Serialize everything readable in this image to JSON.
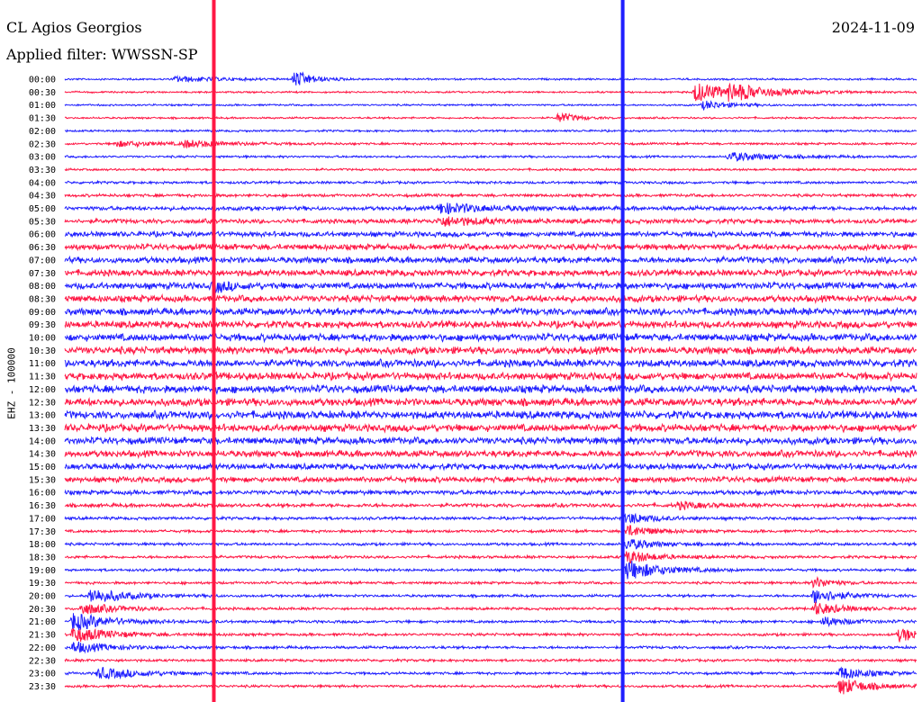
{
  "header": {
    "title": "CL Agios Georgios",
    "date": "2024-11-09",
    "filter": "Applied filter: WWSSN-SP"
  },
  "chart_data": {
    "type": "line",
    "title": "CL Agios Georgios",
    "subtitle": "Applied filter: WWSSN-SP",
    "ylabel": "EHZ - 100000",
    "date": "2024-11-09",
    "colors": [
      "#1f1fff",
      "#ff1744"
    ],
    "rows": [
      {
        "label": "00:00",
        "noise": 0.1,
        "events": [
          {
            "x": 0.27,
            "amp": 0.8,
            "decay": 0.02
          },
          {
            "x": 0.13,
            "amp": 0.25,
            "decay": 0.05
          }
        ]
      },
      {
        "label": "00:30",
        "noise": 0.1,
        "events": [
          {
            "x": 0.74,
            "amp": 0.9,
            "decay": 0.04
          },
          {
            "x": 0.78,
            "amp": 0.6,
            "decay": 0.05
          }
        ]
      },
      {
        "label": "01:00",
        "noise": 0.1,
        "events": [
          {
            "x": 0.75,
            "amp": 0.4,
            "decay": 0.03
          }
        ]
      },
      {
        "label": "01:30",
        "noise": 0.1,
        "events": [
          {
            "x": 0.58,
            "amp": 0.5,
            "decay": 0.02
          }
        ]
      },
      {
        "label": "02:00",
        "noise": 0.11,
        "events": []
      },
      {
        "label": "02:30",
        "noise": 0.12,
        "events": [
          {
            "x": 0.14,
            "amp": 0.3,
            "decay": 0.05
          },
          {
            "x": 0.06,
            "amp": 0.25,
            "decay": 0.05
          }
        ]
      },
      {
        "label": "03:00",
        "noise": 0.12,
        "events": [
          {
            "x": 0.78,
            "amp": 0.4,
            "decay": 0.05
          }
        ]
      },
      {
        "label": "03:30",
        "noise": 0.12,
        "events": []
      },
      {
        "label": "04:00",
        "noise": 0.14,
        "events": []
      },
      {
        "label": "04:30",
        "noise": 0.16,
        "events": []
      },
      {
        "label": "05:00",
        "noise": 0.22,
        "events": [
          {
            "x": 0.44,
            "amp": 0.5,
            "decay": 0.05
          }
        ]
      },
      {
        "label": "05:30",
        "noise": 0.24,
        "events": [
          {
            "x": 0.44,
            "amp": 0.4,
            "decay": 0.05
          }
        ]
      },
      {
        "label": "06:00",
        "noise": 0.28,
        "events": []
      },
      {
        "label": "06:30",
        "noise": 0.32,
        "events": []
      },
      {
        "label": "07:00",
        "noise": 0.34,
        "events": []
      },
      {
        "label": "07:30",
        "noise": 0.34,
        "events": []
      },
      {
        "label": "08:00",
        "noise": 0.36,
        "events": [
          {
            "x": 0.175,
            "amp": 0.5,
            "decay": 0.02
          }
        ]
      },
      {
        "label": "08:30",
        "noise": 0.36,
        "events": []
      },
      {
        "label": "09:00",
        "noise": 0.38,
        "events": []
      },
      {
        "label": "09:30",
        "noise": 0.38,
        "events": []
      },
      {
        "label": "10:00",
        "noise": 0.4,
        "events": []
      },
      {
        "label": "10:30",
        "noise": 0.4,
        "events": []
      },
      {
        "label": "11:00",
        "noise": 0.4,
        "events": []
      },
      {
        "label": "11:30",
        "noise": 0.4,
        "events": []
      },
      {
        "label": "12:00",
        "noise": 0.42,
        "events": []
      },
      {
        "label": "12:30",
        "noise": 0.42,
        "events": []
      },
      {
        "label": "13:00",
        "noise": 0.42,
        "events": []
      },
      {
        "label": "13:30",
        "noise": 0.4,
        "events": []
      },
      {
        "label": "14:00",
        "noise": 0.38,
        "events": []
      },
      {
        "label": "14:30",
        "noise": 0.36,
        "events": []
      },
      {
        "label": "15:00",
        "noise": 0.32,
        "events": []
      },
      {
        "label": "15:30",
        "noise": 0.3,
        "events": []
      },
      {
        "label": "16:00",
        "noise": 0.24,
        "events": []
      },
      {
        "label": "16:30",
        "noise": 0.2,
        "events": [
          {
            "x": 0.72,
            "amp": 0.3,
            "decay": 0.03
          }
        ]
      },
      {
        "label": "17:00",
        "noise": 0.16,
        "events": [
          {
            "x": 0.66,
            "amp": 0.5,
            "decay": 0.03
          }
        ]
      },
      {
        "label": "17:30",
        "noise": 0.15,
        "events": [
          {
            "x": 0.66,
            "amp": 0.5,
            "decay": 0.03
          }
        ]
      },
      {
        "label": "18:00",
        "noise": 0.15,
        "events": [
          {
            "x": 0.66,
            "amp": 0.5,
            "decay": 0.03
          }
        ]
      },
      {
        "label": "18:30",
        "noise": 0.15,
        "events": [
          {
            "x": 0.66,
            "amp": 0.6,
            "decay": 0.03
          }
        ]
      },
      {
        "label": "19:00",
        "noise": 0.14,
        "events": [
          {
            "x": 0.66,
            "amp": 0.9,
            "decay": 0.04
          }
        ]
      },
      {
        "label": "19:30",
        "noise": 0.14,
        "events": [
          {
            "x": 0.88,
            "amp": 0.5,
            "decay": 0.02
          }
        ]
      },
      {
        "label": "20:00",
        "noise": 0.14,
        "events": [
          {
            "x": 0.03,
            "amp": 0.7,
            "decay": 0.04
          },
          {
            "x": 0.88,
            "amp": 0.7,
            "decay": 0.03
          }
        ]
      },
      {
        "label": "20:30",
        "noise": 0.14,
        "events": [
          {
            "x": 0.02,
            "amp": 0.5,
            "decay": 0.04
          },
          {
            "x": 0.88,
            "amp": 0.6,
            "decay": 0.03
          }
        ]
      },
      {
        "label": "21:00",
        "noise": 0.15,
        "events": [
          {
            "x": 0.01,
            "amp": 0.8,
            "decay": 0.04
          },
          {
            "x": 0.89,
            "amp": 0.4,
            "decay": 0.03
          }
        ]
      },
      {
        "label": "21:30",
        "noise": 0.15,
        "events": [
          {
            "x": 0.01,
            "amp": 0.7,
            "decay": 0.04
          },
          {
            "x": 0.98,
            "amp": 0.6,
            "decay": 0.03
          }
        ]
      },
      {
        "label": "22:00",
        "noise": 0.15,
        "events": [
          {
            "x": 0.01,
            "amp": 0.5,
            "decay": 0.04
          }
        ]
      },
      {
        "label": "22:30",
        "noise": 0.14,
        "events": []
      },
      {
        "label": "23:00",
        "noise": 0.14,
        "events": [
          {
            "x": 0.04,
            "amp": 0.5,
            "decay": 0.05
          },
          {
            "x": 0.91,
            "amp": 0.6,
            "decay": 0.03
          }
        ]
      },
      {
        "label": "23:30",
        "noise": 0.14,
        "events": [
          {
            "x": 0.91,
            "amp": 0.8,
            "decay": 0.03
          }
        ]
      }
    ],
    "spikes": [
      {
        "x": 0.175,
        "color": "#ff1744"
      },
      {
        "x": 0.655,
        "color": "#1f1fff"
      }
    ]
  }
}
